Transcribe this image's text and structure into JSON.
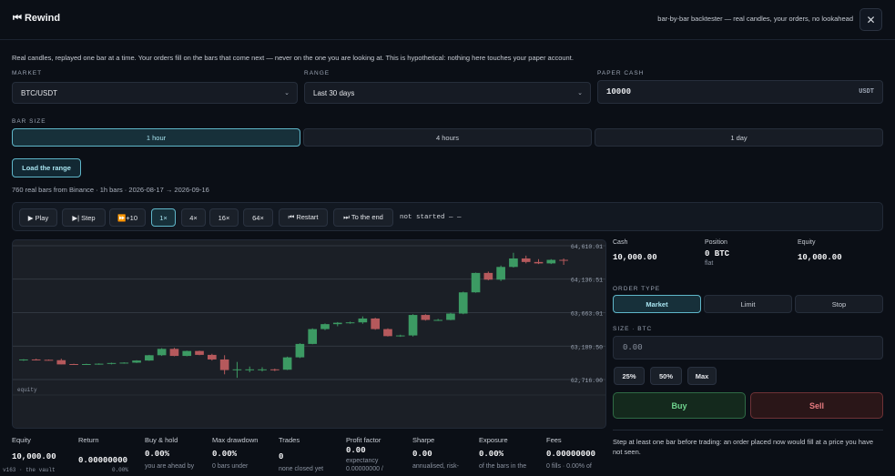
{
  "header": {
    "app_title": "⏮ Rewind",
    "tagline": "bar-by-bar backtester — real candles, your orders, no lookahead",
    "close_glyph": "✕"
  },
  "intro": "Real candles, replayed one bar at a time. Your orders fill on the bars that come next — never on the one you are looking at. This is hypothetical: nothing here touches your paper account.",
  "form": {
    "market_label": "MARKET",
    "market_value": "BTC/USDT",
    "range_label": "RANGE",
    "range_value": "Last 30 days",
    "cash_label": "PAPER CASH",
    "cash_value": "10000",
    "cash_unit": "USDT",
    "bar_size_label": "BAR SIZE",
    "bar_sizes": [
      "1 hour",
      "4 hours",
      "1 day"
    ],
    "bar_size_selected": "1 hour",
    "load_label": "Load the range",
    "bars_info": "760 real bars from Binance · 1h bars · 2026-08-17 → 2026-09-16"
  },
  "controls": {
    "play": "▶ Play",
    "step": "▶| Step",
    "plus10": "⏩+10",
    "speeds": [
      "1×",
      "4×",
      "16×",
      "64×"
    ],
    "speed_selected": "1×",
    "restart": "⏮ Restart",
    "to_end": "⏭ To the end",
    "status": "not started — —"
  },
  "chart_data": {
    "type": "candlestick",
    "y_ticks": [
      "64,610.01",
      "64,136.51",
      "63,663.01",
      "63,189.50",
      "62,716.00"
    ],
    "y_tick_values": [
      64610.01,
      64136.51,
      63663.01,
      63189.5,
      62716.0
    ],
    "ylim": [
      62716.0,
      64610.01
    ],
    "grid": true,
    "candles_ohlc_approx": [
      [
        62995,
        63005,
        62980,
        63000
      ],
      [
        63000,
        63010,
        62985,
        62995
      ],
      [
        62995,
        63000,
        62985,
        62990
      ],
      [
        62990,
        63010,
        62930,
        62930
      ],
      [
        62935,
        62940,
        62925,
        62930
      ],
      [
        62930,
        62940,
        62925,
        62935
      ],
      [
        62935,
        62945,
        62925,
        62940
      ],
      [
        62940,
        62955,
        62930,
        62950
      ],
      [
        62950,
        62960,
        62940,
        62955
      ],
      [
        62955,
        62990,
        62950,
        62985
      ],
      [
        62985,
        63065,
        62980,
        63060
      ],
      [
        63060,
        63160,
        63050,
        63150
      ],
      [
        63150,
        63165,
        63045,
        63050
      ],
      [
        63050,
        63125,
        63045,
        63120
      ],
      [
        63120,
        63125,
        63060,
        63065
      ],
      [
        63065,
        63080,
        62985,
        63000
      ],
      [
        63000,
        63060,
        62790,
        62850
      ],
      [
        62850,
        62965,
        62740,
        62860
      ],
      [
        62860,
        62900,
        62820,
        62860
      ],
      [
        62860,
        62890,
        62830,
        62860
      ],
      [
        62860,
        62870,
        62835,
        62855
      ],
      [
        62855,
        63040,
        62850,
        63030
      ],
      [
        63030,
        63230,
        63020,
        63220
      ],
      [
        63220,
        63440,
        63215,
        63430
      ],
      [
        63430,
        63510,
        63415,
        63500
      ],
      [
        63500,
        63530,
        63470,
        63520
      ],
      [
        63520,
        63535,
        63505,
        63525
      ],
      [
        63525,
        63610,
        63505,
        63580
      ],
      [
        63580,
        63590,
        63420,
        63430
      ],
      [
        63430,
        63440,
        63325,
        63330
      ],
      [
        63330,
        63350,
        63320,
        63340
      ],
      [
        63340,
        63640,
        63325,
        63630
      ],
      [
        63630,
        63640,
        63550,
        63560
      ],
      [
        63560,
        63575,
        63545,
        63560
      ],
      [
        63560,
        63660,
        63555,
        63650
      ],
      [
        63650,
        63960,
        63640,
        63950
      ],
      [
        63950,
        64230,
        63945,
        64225
      ],
      [
        64225,
        64245,
        64120,
        64130
      ],
      [
        64130,
        64330,
        64110,
        64310
      ],
      [
        64310,
        64510,
        64300,
        64430
      ],
      [
        64430,
        64470,
        64360,
        64380
      ],
      [
        64380,
        64420,
        64350,
        64360
      ],
      [
        64360,
        64420,
        64350,
        64410
      ],
      [
        64410,
        64430,
        64340,
        64400
      ]
    ],
    "equity_label": "equity"
  },
  "account": {
    "cash_label": "Cash",
    "cash_value": "10,000.00",
    "position_label": "Position",
    "position_value": "0 BTC",
    "position_sub": "flat",
    "equity_label": "Equity",
    "equity_value": "10,000.00"
  },
  "order": {
    "type_label": "ORDER TYPE",
    "types": [
      "Market",
      "Limit",
      "Stop"
    ],
    "type_selected": "Market",
    "size_label": "SIZE · BTC",
    "size_placeholder": "0.00",
    "pcts": [
      "25%",
      "50%",
      "Max"
    ],
    "buy": "Buy",
    "sell": "Sell",
    "hint": "Step at least one bar before trading: an order placed now would fill at a price you have not seen."
  },
  "stats": [
    {
      "label": "Equity",
      "value": "10,000.00",
      "sub": ""
    },
    {
      "label": "Return",
      "value": "0.00000000",
      "sub": ""
    },
    {
      "label": "Buy & hold",
      "value": "0.00%",
      "sub": "you are ahead by"
    },
    {
      "label": "Max drawdown",
      "value": "0.00%",
      "sub": "0 bars under"
    },
    {
      "label": "Trades",
      "value": "0",
      "sub": "none closed yet"
    },
    {
      "label": "Profit factor",
      "value": "0.00",
      "sub": "expectancy 0.00000000 /"
    },
    {
      "label": "Sharpe",
      "value": "0.00",
      "sub": "annualised, risk-"
    },
    {
      "label": "Exposure",
      "value": "0.00%",
      "sub": "of the bars in the"
    },
    {
      "label": "Fees",
      "value": "0.00000000",
      "sub": "0 fills · 0.00% of"
    }
  ],
  "spark": {
    "left": "v163 · the vault",
    "right": "0.00%"
  },
  "colors": {
    "accent": "#5fb6c9",
    "up": "#3c9a63",
    "down": "#b5595c",
    "buy": "#6fd48e",
    "sell": "#e77b80"
  }
}
